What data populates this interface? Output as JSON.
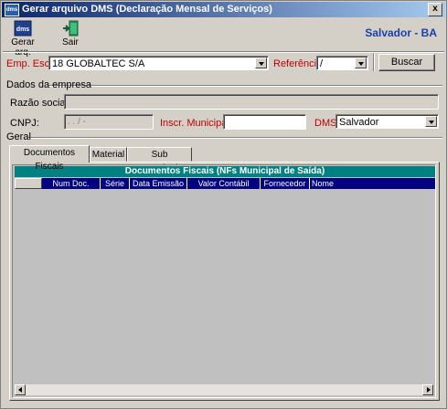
{
  "window": {
    "title": "Gerar arquivo DMS (Declaração Mensal de Serviços)",
    "close_label": "x",
    "app_icon": "dms"
  },
  "toolbar": {
    "gerar_label": "Gerar arq.",
    "sair_label": "Sair",
    "city": "Salvador - BA"
  },
  "empresa_row": {
    "emp_label": "Emp. Escr.:",
    "emp_value": "18  GLOBALTEC S/A",
    "ref_label": "Referência:",
    "ref_value": " /",
    "buscar_label": "Buscar"
  },
  "dados": {
    "group_label": "Dados da empresa",
    "razao_label": "Razão social:",
    "razao_value": "",
    "cnpj_label": "CNPJ:",
    "cnpj_value": " .   .   /   -",
    "inscr_label": "Inscr. Municipal:",
    "inscr_value": "",
    "dms_label": "DMS:",
    "dms_value": "Salvador"
  },
  "geral": {
    "group_label": "Geral"
  },
  "tabs": [
    {
      "label": "Documentos Fiscais"
    },
    {
      "label": "Material"
    },
    {
      "label": "Sub Empreitada"
    }
  ],
  "grid": {
    "title": "Documentos Fiscais (NFs Municipal de Saída)",
    "columns": [
      "Num Doc.",
      "Série",
      "Data Emissão",
      "Valor Contábil",
      "Fornecedor",
      "Nome"
    ]
  }
}
